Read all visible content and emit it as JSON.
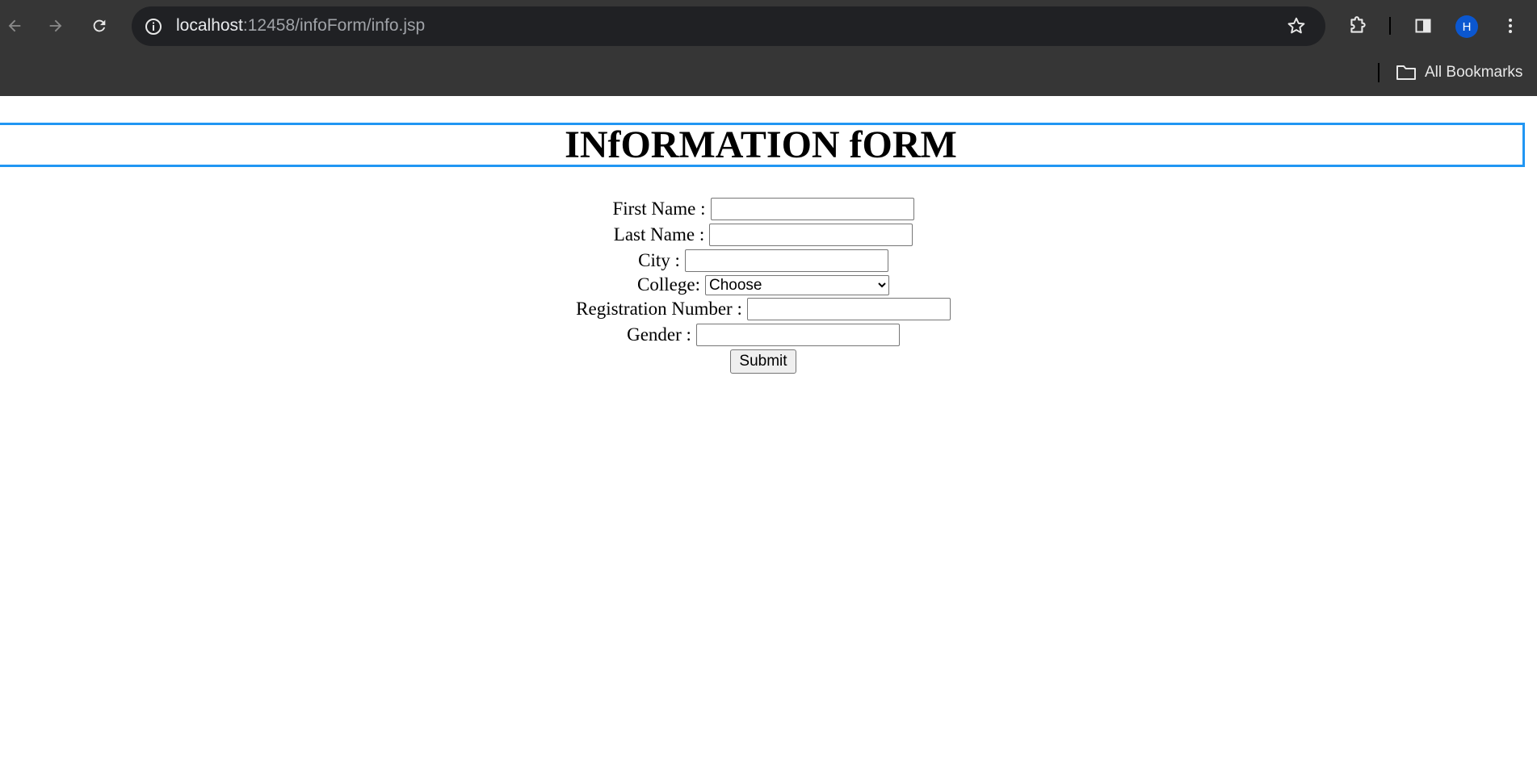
{
  "browser": {
    "url_host": "localhost",
    "url_path": ":12458/infoForm/info.jsp",
    "profile_initial": "H",
    "bookmarks_label": "All Bookmarks"
  },
  "page": {
    "title": "INfORMATION fORM",
    "title_border_color": "#2196f3",
    "fields": {
      "first_name_label": "First Name :",
      "last_name_label": "Last Name :",
      "city_label": "City :",
      "college_label": "College:",
      "college_selected": "Choose",
      "registration_label": "Registration Number :",
      "gender_label": "Gender :"
    },
    "submit_label": "Submit"
  }
}
